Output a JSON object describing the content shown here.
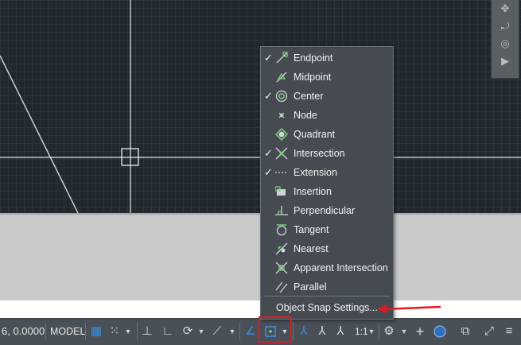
{
  "status_bar": {
    "coordinates": "6, 0.0000",
    "model_label": "MODEL",
    "scale_label": "1:1"
  },
  "osnap_menu": {
    "items": [
      {
        "label": "Endpoint",
        "checked": true,
        "icon": "endpoint-icon"
      },
      {
        "label": "Midpoint",
        "checked": false,
        "icon": "midpoint-icon"
      },
      {
        "label": "Center",
        "checked": true,
        "icon": "center-icon"
      },
      {
        "label": "Node",
        "checked": false,
        "icon": "node-icon"
      },
      {
        "label": "Quadrant",
        "checked": false,
        "icon": "quadrant-icon"
      },
      {
        "label": "Intersection",
        "checked": true,
        "icon": "intersection-icon"
      },
      {
        "label": "Extension",
        "checked": true,
        "icon": "extension-icon"
      },
      {
        "label": "Insertion",
        "checked": false,
        "icon": "insertion-icon"
      },
      {
        "label": "Perpendicular",
        "checked": false,
        "icon": "perpendicular-icon"
      },
      {
        "label": "Tangent",
        "checked": false,
        "icon": "tangent-icon"
      },
      {
        "label": "Nearest",
        "checked": false,
        "icon": "nearest-icon"
      },
      {
        "label": "Apparent Intersection",
        "checked": false,
        "icon": "apparent-intersection-icon"
      },
      {
        "label": "Parallel",
        "checked": false,
        "icon": "parallel-icon"
      }
    ],
    "settings_label": "Object Snap Settings...",
    "check_glyph": "✓"
  },
  "colors": {
    "snap_icon": "#7ad27a",
    "annotation_red": "#e8161c",
    "status_blue": "#3c8fe0"
  }
}
